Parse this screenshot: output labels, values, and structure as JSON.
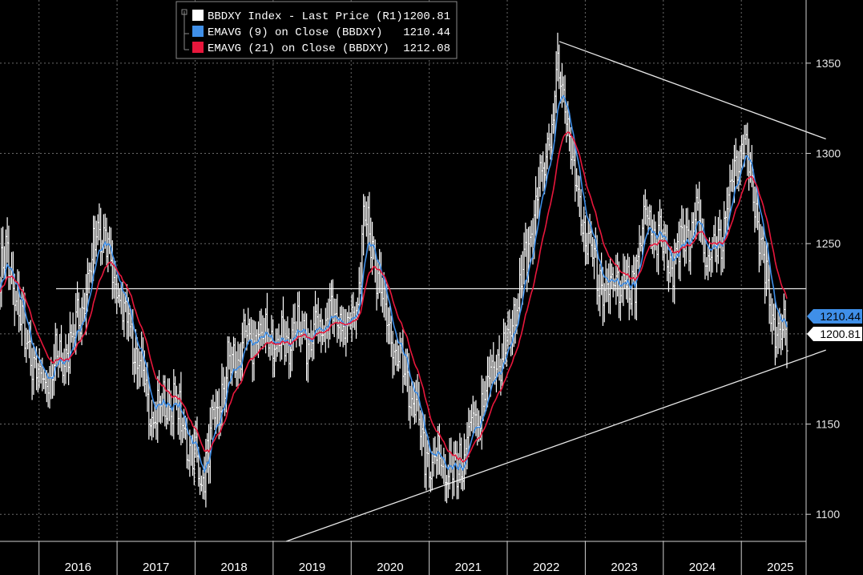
{
  "chart_data": {
    "type": "line",
    "x_start": "2015-07",
    "x_step": "1 week",
    "x_end": "2025-08",
    "ylim": [
      1085,
      1385
    ],
    "y_ticks": [
      1100,
      1150,
      1200,
      1250,
      1300,
      1350
    ],
    "y_tick_labels": [
      "1100",
      "1150",
      "",
      "1250",
      "1300",
      "1350"
    ],
    "x_categories": [
      "2016",
      "2017",
      "2018",
      "2019",
      "2020",
      "2021",
      "2022",
      "2023",
      "2024",
      "2025"
    ],
    "grid": true,
    "legend_position": "top-center",
    "background_color": "#000000",
    "series": [
      {
        "name": "BBDXY Index - Last Price (R1)",
        "last_value": "1200.81",
        "color": "#ffffff",
        "style": "ohlc-bars",
        "anchors": [
          [
            "2015-07",
            1230
          ],
          [
            "2015-08",
            1245
          ],
          [
            "2015-10",
            1210
          ],
          [
            "2015-12",
            1185
          ],
          [
            "2016-01",
            1170
          ],
          [
            "2016-03",
            1180
          ],
          [
            "2016-06",
            1195
          ],
          [
            "2016-09",
            1235
          ],
          [
            "2016-10",
            1260
          ],
          [
            "2016-12",
            1240
          ],
          [
            "2017-01",
            1225
          ],
          [
            "2017-03",
            1205
          ],
          [
            "2017-05",
            1170
          ],
          [
            "2017-07",
            1155
          ],
          [
            "2017-09",
            1165
          ],
          [
            "2017-11",
            1150
          ],
          [
            "2018-01",
            1130
          ],
          [
            "2018-02",
            1120
          ],
          [
            "2018-03",
            1135
          ],
          [
            "2018-06",
            1180
          ],
          [
            "2018-09",
            1195
          ],
          [
            "2018-11",
            1200
          ],
          [
            "2019-02",
            1195
          ],
          [
            "2019-06",
            1200
          ],
          [
            "2019-10",
            1210
          ],
          [
            "2019-12",
            1205
          ],
          [
            "2020-02",
            1215
          ],
          [
            "2020-03",
            1275
          ],
          [
            "2020-04",
            1250
          ],
          [
            "2020-06",
            1215
          ],
          [
            "2020-08",
            1185
          ],
          [
            "2020-10",
            1170
          ],
          [
            "2020-12",
            1140
          ],
          [
            "2021-01",
            1125
          ],
          [
            "2021-03",
            1130
          ],
          [
            "2021-05",
            1120
          ],
          [
            "2021-07",
            1145
          ],
          [
            "2021-09",
            1160
          ],
          [
            "2021-11",
            1180
          ],
          [
            "2022-01",
            1195
          ],
          [
            "2022-03",
            1225
          ],
          [
            "2022-05",
            1260
          ],
          [
            "2022-07",
            1300
          ],
          [
            "2022-09",
            1345
          ],
          [
            "2022-10",
            1330
          ],
          [
            "2022-12",
            1270
          ],
          [
            "2023-02",
            1240
          ],
          [
            "2023-04",
            1225
          ],
          [
            "2023-06",
            1235
          ],
          [
            "2023-08",
            1220
          ],
          [
            "2023-10",
            1265
          ],
          [
            "2023-12",
            1255
          ],
          [
            "2024-02",
            1235
          ],
          [
            "2024-04",
            1250
          ],
          [
            "2024-06",
            1265
          ],
          [
            "2024-08",
            1240
          ],
          [
            "2024-10",
            1255
          ],
          [
            "2024-12",
            1290
          ],
          [
            "2025-01",
            1310
          ],
          [
            "2025-03",
            1280
          ],
          [
            "2025-05",
            1225
          ],
          [
            "2025-07",
            1195
          ],
          [
            "2025-09",
            1205
          ],
          [
            "2025-11",
            1225
          ],
          [
            "2025-12",
            1215
          ],
          [
            "2026-01",
            1201
          ]
        ]
      },
      {
        "name": "EMAVG (9)  on Close (BBDXY)",
        "last_value": "1210.44",
        "color": "#3f8fe8",
        "style": "line",
        "ema_period": 9
      },
      {
        "name": "EMAVG (21)  on Close (BBDXY)",
        "last_value": "1212.08",
        "color": "#e8173c",
        "style": "line",
        "ema_period": 21
      }
    ],
    "annotations": {
      "horizontal_line": 1225,
      "upper_trendline": [
        [
          "2022-09",
          1362
        ],
        [
          "2026-02",
          1308
        ]
      ],
      "lower_trendline": [
        [
          "2019-03",
          1085
        ],
        [
          "2026-02",
          1191
        ]
      ]
    }
  }
}
